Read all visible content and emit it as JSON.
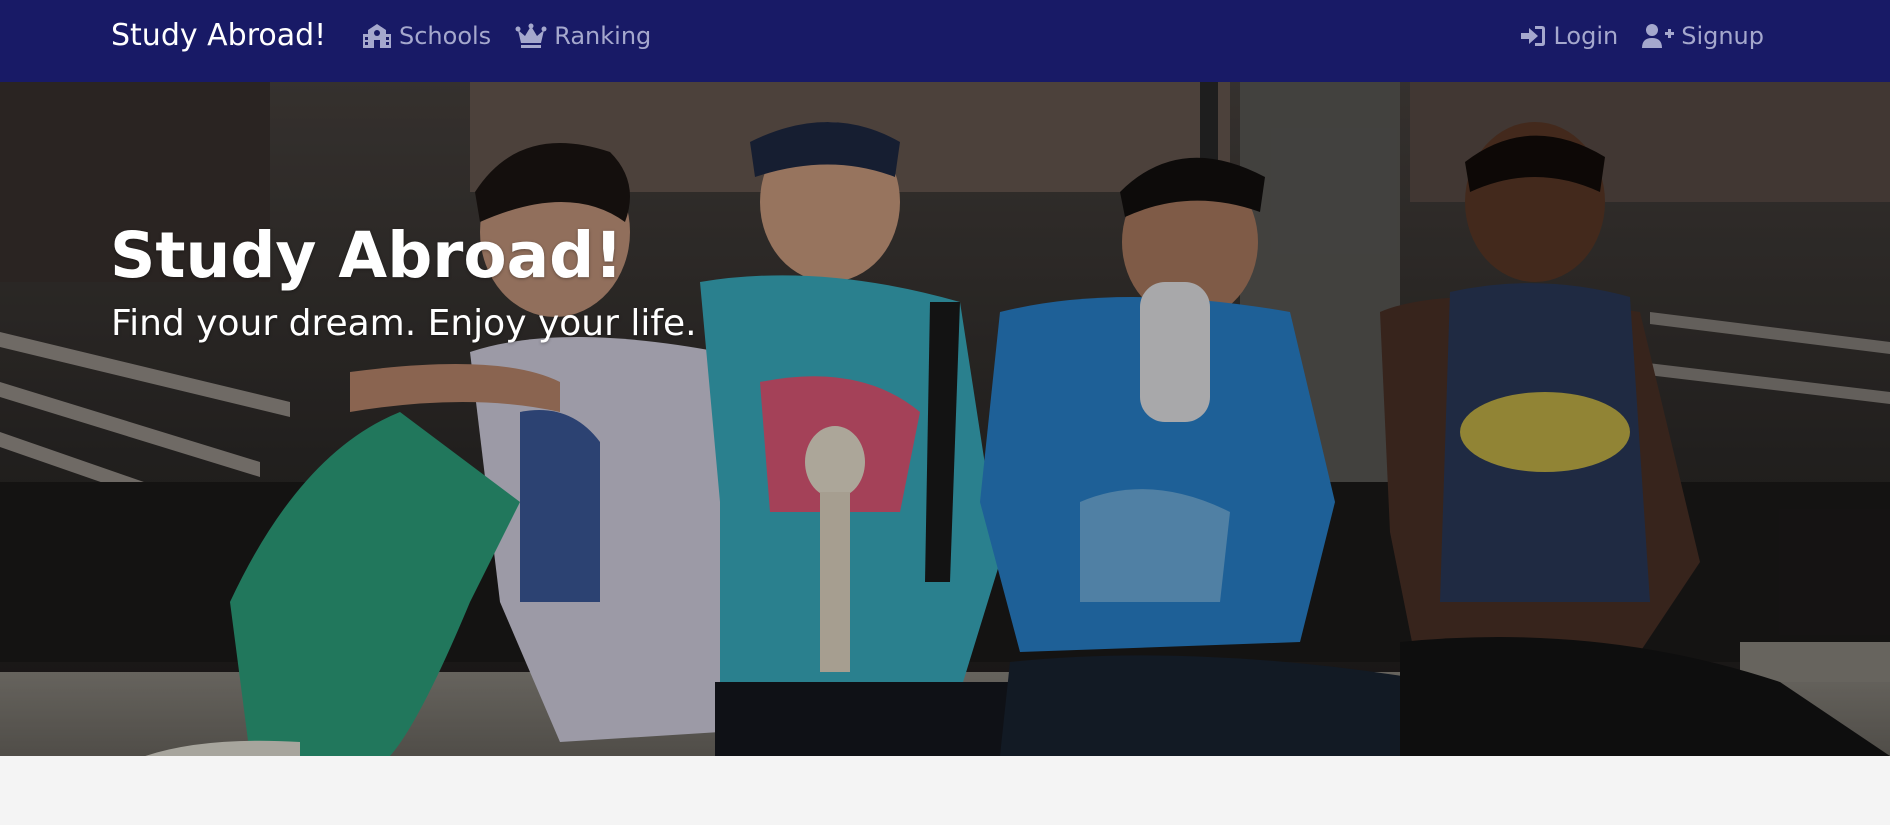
{
  "navbar": {
    "brand": "Study Abroad!",
    "left_links": [
      {
        "label": "Schools",
        "icon": "school-icon"
      },
      {
        "label": "Ranking",
        "icon": "crown-icon"
      }
    ],
    "right_links": [
      {
        "label": "Login",
        "icon": "sign-in-icon"
      },
      {
        "label": "Signup",
        "icon": "user-plus-icon"
      }
    ],
    "colors": {
      "background": "#181a66",
      "brand_text": "#ffffff",
      "link_text": "#a5a8cd"
    }
  },
  "hero": {
    "title": "Study Abroad!",
    "subtitle": "Find your dream. Enjoy your life.",
    "image_description": "four-young-men-sitting-on-ledge-photo"
  },
  "page": {
    "background": "#f4f4f4"
  }
}
